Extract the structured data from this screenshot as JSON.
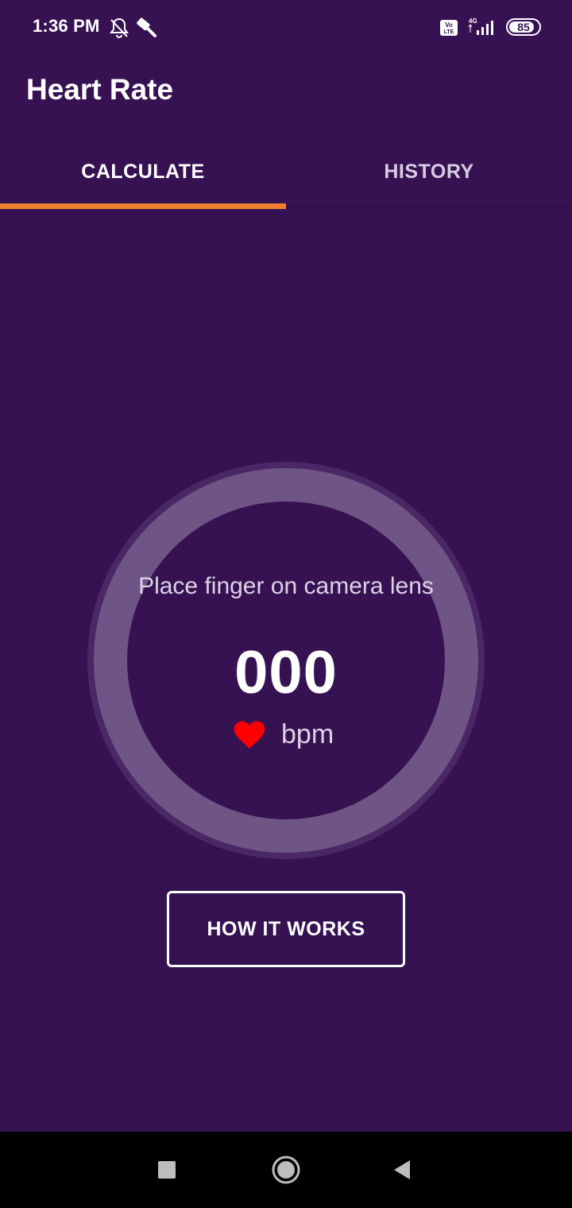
{
  "status_bar": {
    "time": "1:36 PM",
    "icons": [
      "bell-off-icon",
      "hammer-icon",
      "volte-icon",
      "signal-4g-icon",
      "battery-icon"
    ],
    "network": "4G",
    "volte": "Vo LTE",
    "battery_level": "85"
  },
  "app": {
    "title": "Heart Rate"
  },
  "tabs": [
    {
      "label": "CALCULATE",
      "selected": true
    },
    {
      "label": "HISTORY",
      "selected": false
    }
  ],
  "gauge": {
    "prompt": "Place finger on camera lens",
    "value": "000",
    "unit": "bpm",
    "icon": "heart-icon",
    "progress": 0
  },
  "actions": {
    "how_it_works": "HOW IT WORKS"
  },
  "nav": {
    "icons": [
      "recents-square-icon",
      "home-circle-icon",
      "back-triangle-icon"
    ]
  },
  "colors": {
    "background": "#371252",
    "accent": "#F07F30",
    "ring": "#6E5585",
    "heart": "#FF0000"
  }
}
